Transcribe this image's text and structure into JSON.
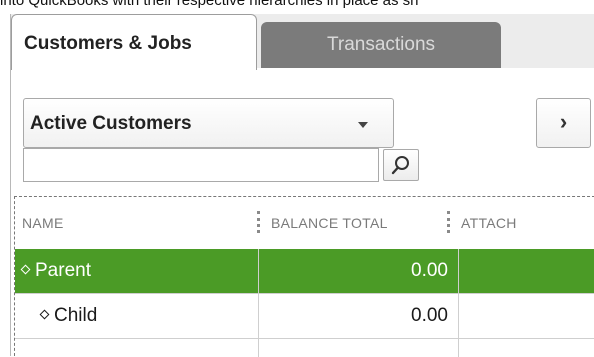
{
  "caption": "into QuickBooks with their respective hierarchies in place as sh",
  "tabs": [
    {
      "label": "Customers & Jobs",
      "active": true
    },
    {
      "label": "Transactions",
      "active": false
    }
  ],
  "filter": {
    "selected": "Active Customers"
  },
  "nav_button": {
    "label": "›"
  },
  "search": {
    "value": "",
    "placeholder": ""
  },
  "table": {
    "columns": [
      "NAME",
      "BALANCE TOTAL",
      "ATTACH"
    ],
    "rows": [
      {
        "name": "Parent",
        "balance": "0.00",
        "attach": "",
        "selected": true
      },
      {
        "name": "Child",
        "balance": "0.00",
        "attach": "",
        "selected": false
      }
    ]
  },
  "colors": {
    "selection": "#4b9b26",
    "inactive_tab": "#7b7b7b"
  }
}
